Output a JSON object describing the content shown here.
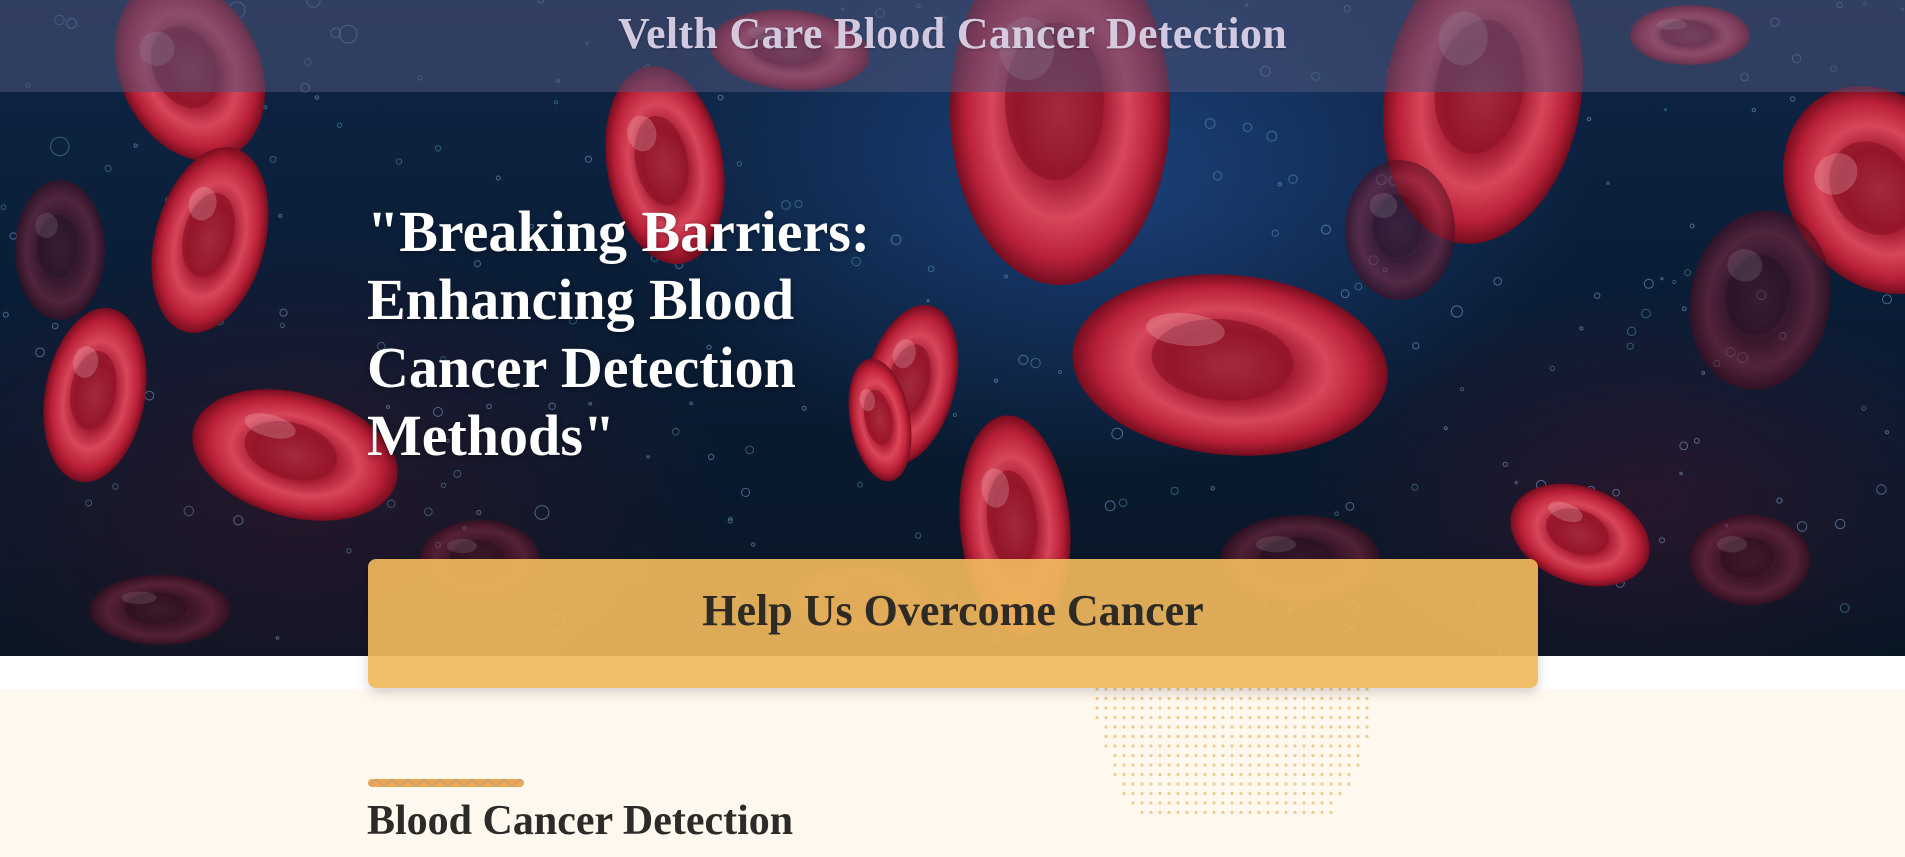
{
  "header": {
    "site_title": "Velth Care Blood Cancer Detection"
  },
  "hero": {
    "headline": "\"Breaking Barriers: Enhancing Blood Cancer Detection Methods\"",
    "background_image": "red-blood-cells-illustration"
  },
  "cta": {
    "label": "Help Us Overcome Cancer",
    "color": "#f0b85c"
  },
  "section": {
    "title": "Blood Cancer Detection",
    "accent_color": "#eba757",
    "background_color": "#fff8ef"
  },
  "colors": {
    "hero_bg": "#0a1d36",
    "cell_red": "#c8283e",
    "title_bar": "#4e5478"
  }
}
